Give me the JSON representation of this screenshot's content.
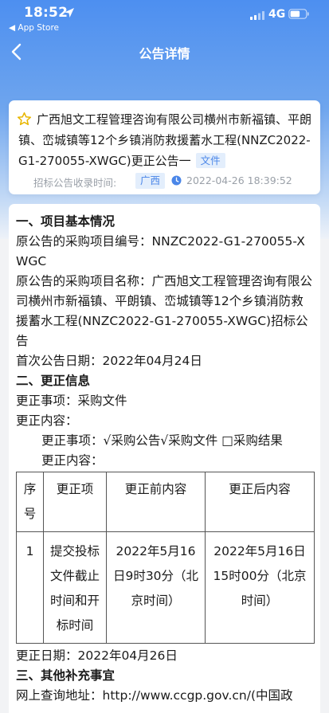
{
  "status_bar": {
    "time": "18:52",
    "back_label": "◀ App Store",
    "network": "4G"
  },
  "nav": {
    "title": "公告详情"
  },
  "notice": {
    "title": "广西旭文工程管理咨询有限公司横州市新福镇、平朗镇、峦城镇等12个乡镇消防救援蓄水工程(NNZC2022-G1-270055-XWGC)更正公告一",
    "doc_tag": "文件",
    "received_label": "招标公告收录时间:",
    "region": "广西",
    "received_time": "2022-04-26 18:39:52"
  },
  "content": {
    "section1": "一、项目基本情况",
    "project_code": "原公告的采购项目编号：NNZC2022-G1-270055-XWGC",
    "project_name": "原公告的采购项目名称：广西旭文工程管理咨询有限公司横州市新福镇、平朗镇、峦城镇等12个乡镇消防救援蓄水工程(NNZC2022-G1-270055-XWGC)招标公告",
    "first_date": "首次公告日期：2022年04月24日",
    "section2": "二、更正信息",
    "change_item": "更正事项：采购文件",
    "change_content_label": "更正内容：",
    "change_matters": "更正事项：√采购公告√采购文件 □采购结果",
    "change_content_label2": "更正内容：",
    "table": {
      "headers": [
        "序号",
        "更正项",
        "更正前内容",
        "更正后内容"
      ],
      "rows": [
        [
          "1",
          "提交投标文件截止时间和开标时间",
          "2022年5月16日9时30分（北京时间）",
          "2022年5月16日15时00分（北京时间）"
        ]
      ]
    },
    "change_date": "更正日期：2022年04月26日",
    "section3": "三、其他补充事宜",
    "online_query": "网上查询地址：http://www.ccgp.gov.cn/(中国政"
  },
  "colors": {
    "header_gradient_top": "#4d8ff0",
    "tag_bg": "#e3eefc",
    "tag_text": "#4a86e8",
    "star": "#e8b600"
  },
  "icons": [
    "location-arrow-icon",
    "signal-icon",
    "battery-icon",
    "back-chevron-icon",
    "star-icon",
    "clock-icon"
  ]
}
